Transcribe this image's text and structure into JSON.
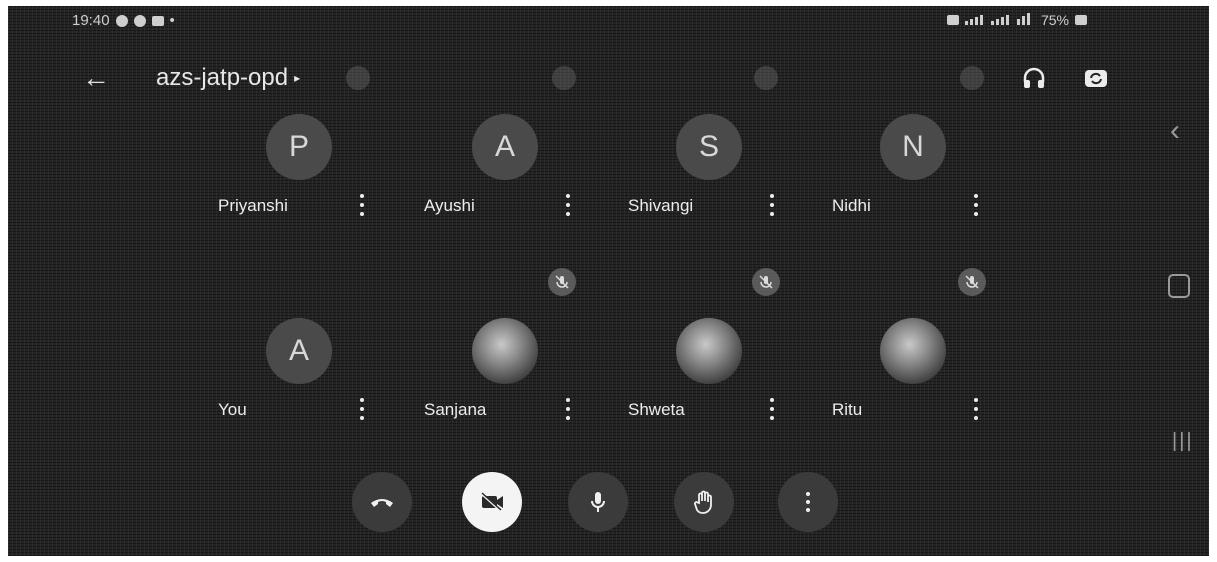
{
  "status_bar": {
    "time": "19:40",
    "battery": "75%"
  },
  "header": {
    "meeting_code": "azs-jatp-opd",
    "back_icon": "arrow-left-icon",
    "audio_icon": "headphones-icon",
    "switch_camera_icon": "switch-camera-icon"
  },
  "participants": [
    {
      "name": "Priyanshi",
      "initial": "P",
      "muted": false
    },
    {
      "name": "Ayushi",
      "initial": "A",
      "muted": false
    },
    {
      "name": "Shivangi",
      "initial": "S",
      "muted": false
    },
    {
      "name": "Nidhi",
      "initial": "N",
      "muted": false
    },
    {
      "name": "You",
      "initial": "A",
      "muted": false
    },
    {
      "name": "Sanjana",
      "initial": "",
      "muted": true
    },
    {
      "name": "Shweta",
      "initial": "",
      "muted": true
    },
    {
      "name": "Ritu",
      "initial": "",
      "muted": true
    }
  ],
  "controls": {
    "end_call_icon": "phone-hangup-icon",
    "camera_icon": "camera-off-icon",
    "mic_icon": "microphone-icon",
    "raise_hand_icon": "raise-hand-icon",
    "more_icon": "more-vertical-icon"
  },
  "colors": {
    "background": "#242424",
    "text": "#e6e6e6",
    "camera_button": "#f4f4f4"
  }
}
